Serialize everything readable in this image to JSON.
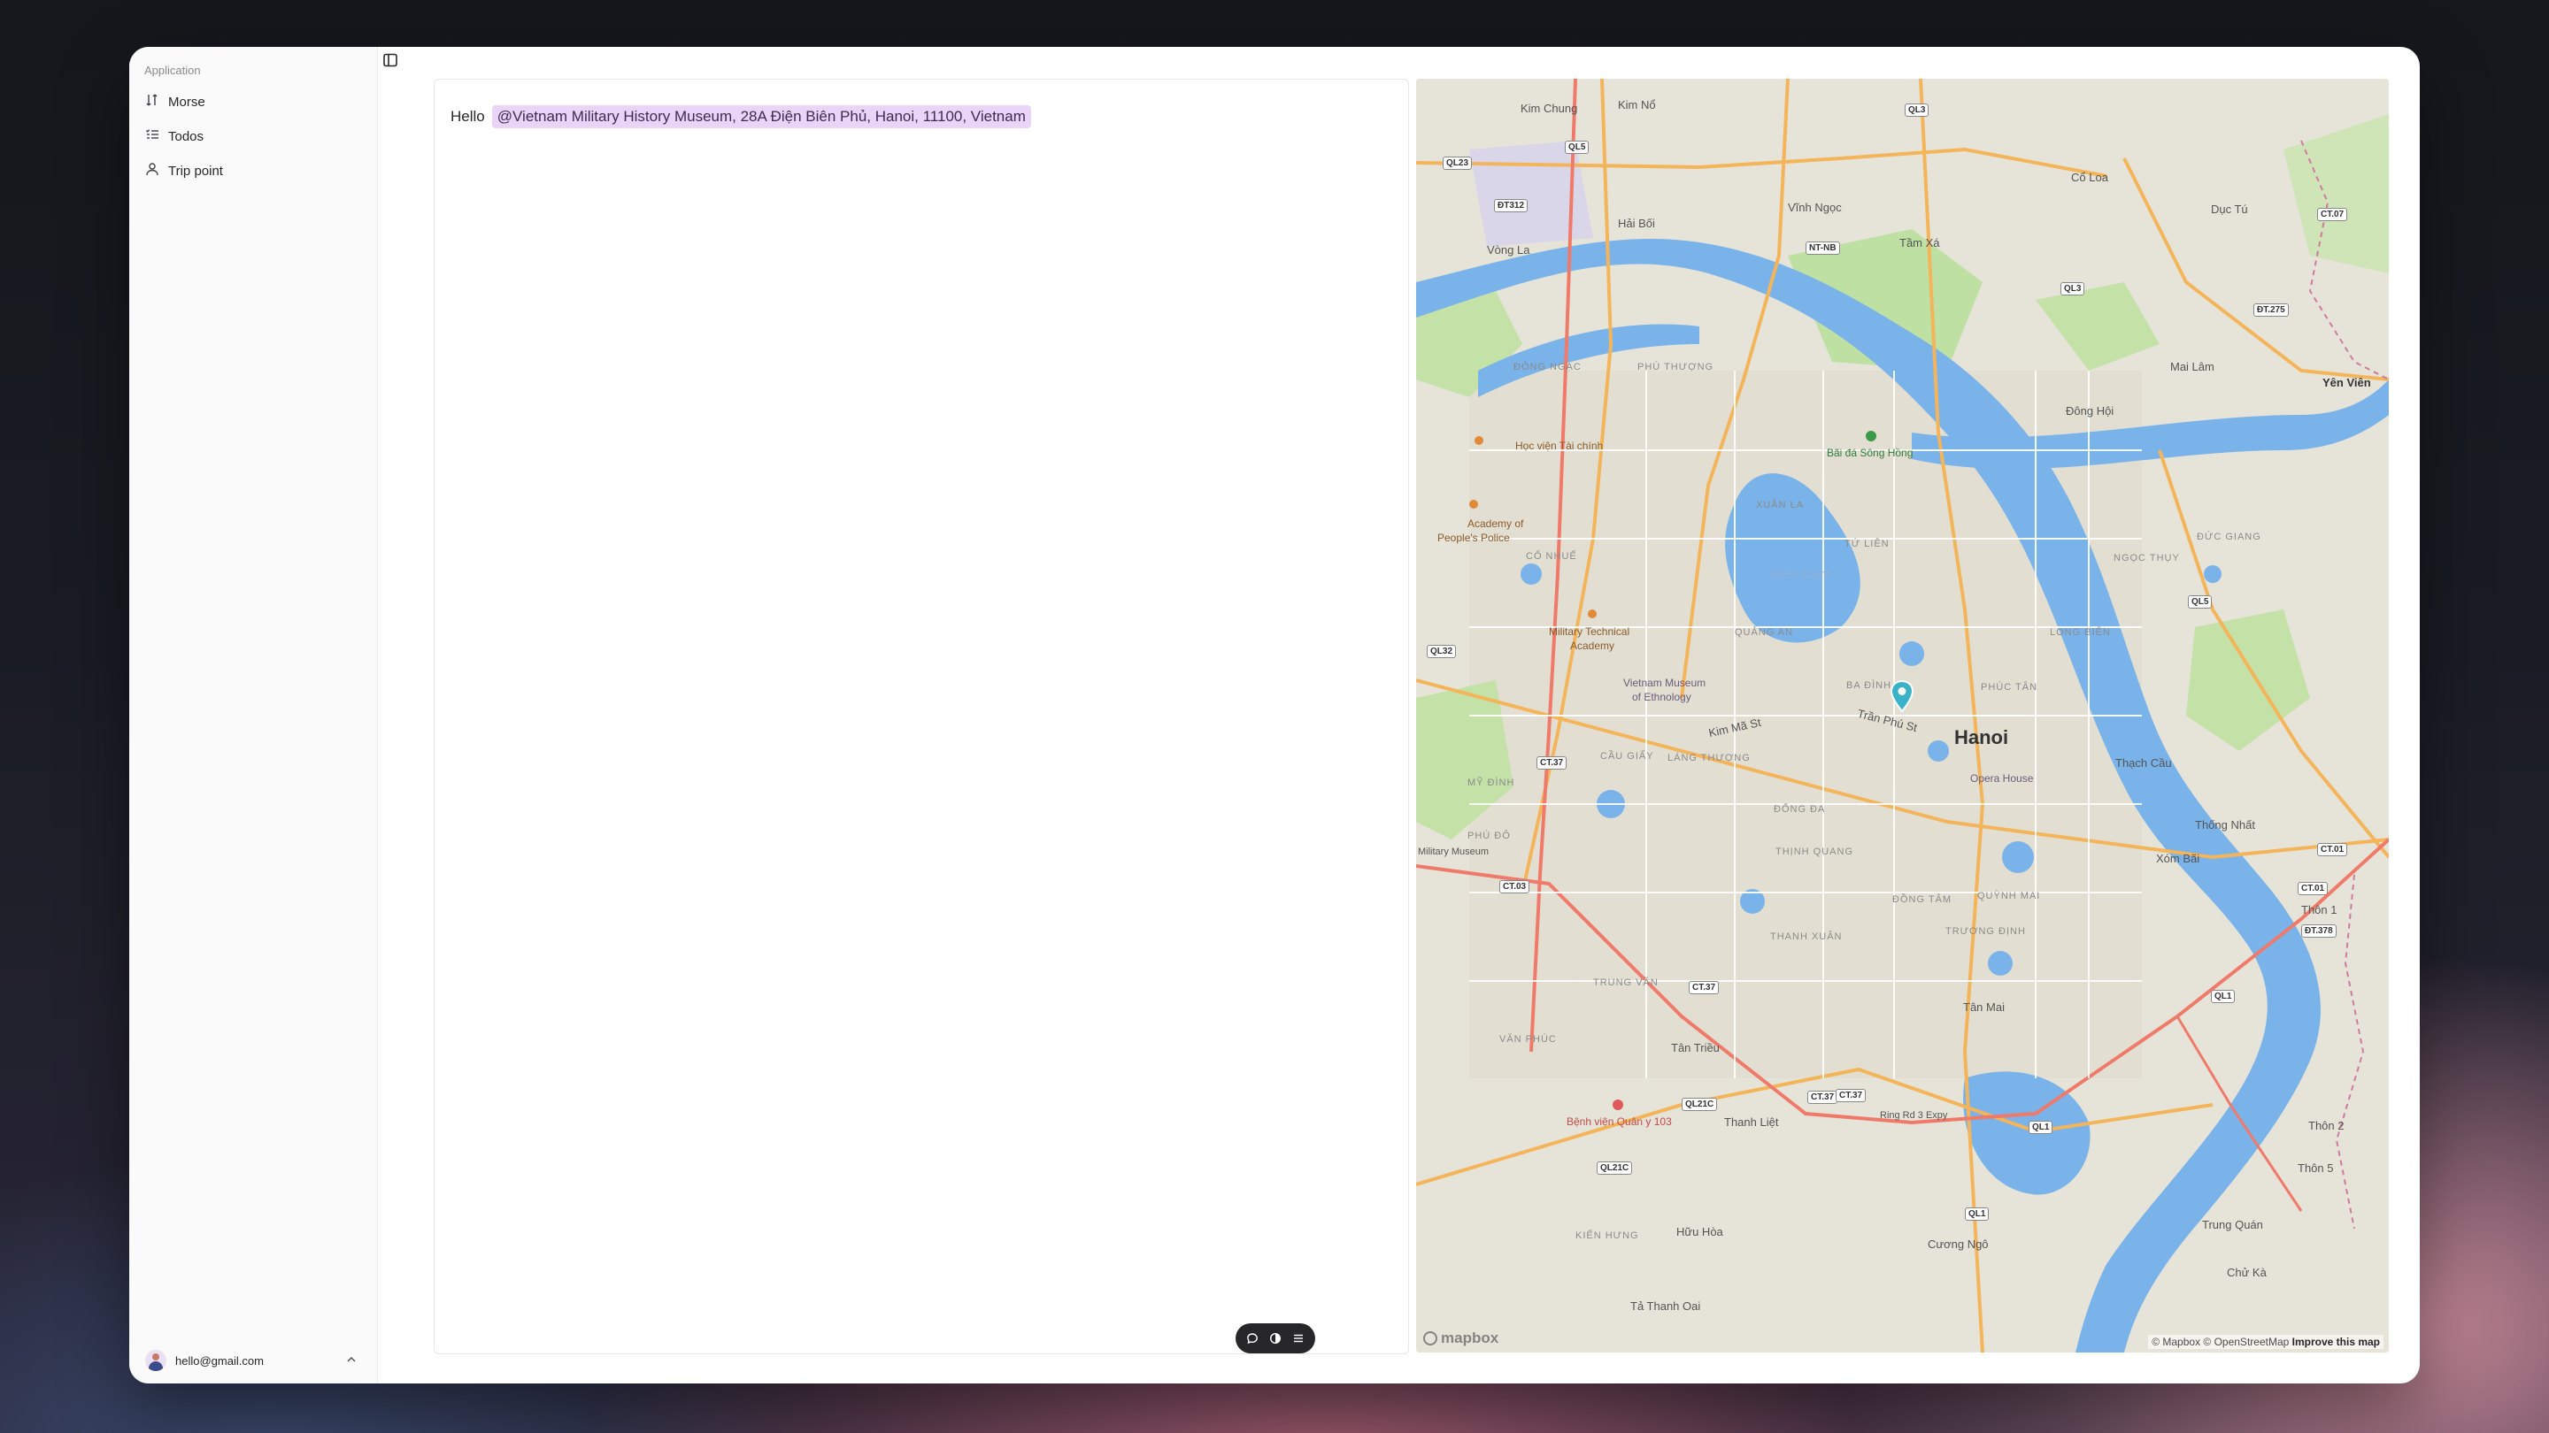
{
  "sidebar": {
    "group_label": "Application",
    "items": [
      {
        "label": "Morse",
        "icon": "morse-icon"
      },
      {
        "label": "Todos",
        "icon": "list-check-icon"
      },
      {
        "label": "Trip point",
        "icon": "user-pin-icon"
      }
    ],
    "user": {
      "email": "hello@gmail.com"
    }
  },
  "editor": {
    "text": "Hello",
    "mention": "@Vietnam Military History Museum, 28A Điện Biên Phủ, Hanoi, 11100, Vietnam"
  },
  "map": {
    "city": "Hanoi",
    "lake": "West Lake",
    "labels": {
      "kim_chung": "Kim Chung",
      "kim_no": "Kim Nổ",
      "hai_boi": "Hải Bối",
      "vinh_ngoc": "Vĩnh Ngọc",
      "vong_la": "Vòng La",
      "tam_xa": "Tầm Xá",
      "co_loa": "Cổ Loa",
      "duc_tu": "Dục Tú",
      "mai_lam": "Mai Lâm",
      "yen_vien": "Yên Viên",
      "dong_hoi": "Đông Hội",
      "hoc_vien": "Học viện Tài chính",
      "bai_da": "Bãi đá Sông Hồng",
      "academy_police_1": "Academy of",
      "academy_police_2": "People's Police",
      "military_tech_1": "Military Technical",
      "military_tech_2": "Academy",
      "ethnology_1": "Vietnam Museum",
      "ethnology_2": "of Ethnology",
      "opera": "Opera House",
      "thach_cau": "Thạch Cầu",
      "thong_nhat": "Thống Nhất",
      "xom_bai": "Xóm Bãi",
      "thon1": "Thôn 1",
      "thon2": "Thôn 2",
      "thon5": "Thôn 5",
      "trung_quan": "Trung Quán",
      "chu_ka": "Chử Kà",
      "tan_mai": "Tân Mai",
      "tan_trieu": "Tân Triều",
      "thanh_liet": "Thanh Liệt",
      "huu_hoa": "Hữu Hòa",
      "cuong_ngo": "Cương Ngô",
      "ta_thanh_oai": "Tả Thanh Oai",
      "benh_vien": "Bệnh viện Quân y 103",
      "ring_road": "Ring Rd 3 Expy",
      "kim_ma": "Kim Mã St",
      "tran_phu": "Trần Phú St",
      "military_museum": "Military Museum"
    },
    "districts": [
      "ĐÔNG NGẠC",
      "PHÚ THƯỢNG",
      "CỔ NHUẾ",
      "XUÂN LA",
      "TỨ LIÊN",
      "QUẢNG AN",
      "BA ĐÌNH",
      "CẦU GIẤY",
      "LÁNG THƯỢNG",
      "ĐỐNG ĐA",
      "THỊNH QUANG",
      "ĐỒNG TÂM",
      "TRƯƠNG ĐỊNH",
      "QUỲNH MAI",
      "THANH XUÂN",
      "TRUNG VĂN",
      "VĂN PHÚC",
      "KIẾN HƯNG",
      "ĐỨC GIANG",
      "NGỌC THỤY",
      "PHÚC TÂN",
      "LONG BIÊN",
      "MỸ ĐÌNH",
      "PHÚ ĐÔ"
    ],
    "road_badges": [
      "QL3",
      "QL5",
      "QL23",
      "ĐT312",
      "NT-NB",
      "QL3",
      "ĐT.275",
      "CT.07",
      "QL5",
      "QL32",
      "CT.37",
      "CT.03",
      "CT.37",
      "QL21C",
      "QL21C",
      "QL1",
      "QL1",
      "CT.01",
      "CT.01",
      "CT.37",
      "ĐT.378",
      "QL1",
      "CT.37"
    ],
    "credit": "© Mapbox © OpenStreetMap",
    "improve": "Improve this map",
    "logo": "mapbox"
  },
  "colors": {
    "mention_bg": "#e9d5f7",
    "water": "#79b0e8",
    "park": "#bfe0a3",
    "road_major": "#f4b45a",
    "road_ring": "#f07a6a",
    "pin": "#3ab3c9"
  }
}
